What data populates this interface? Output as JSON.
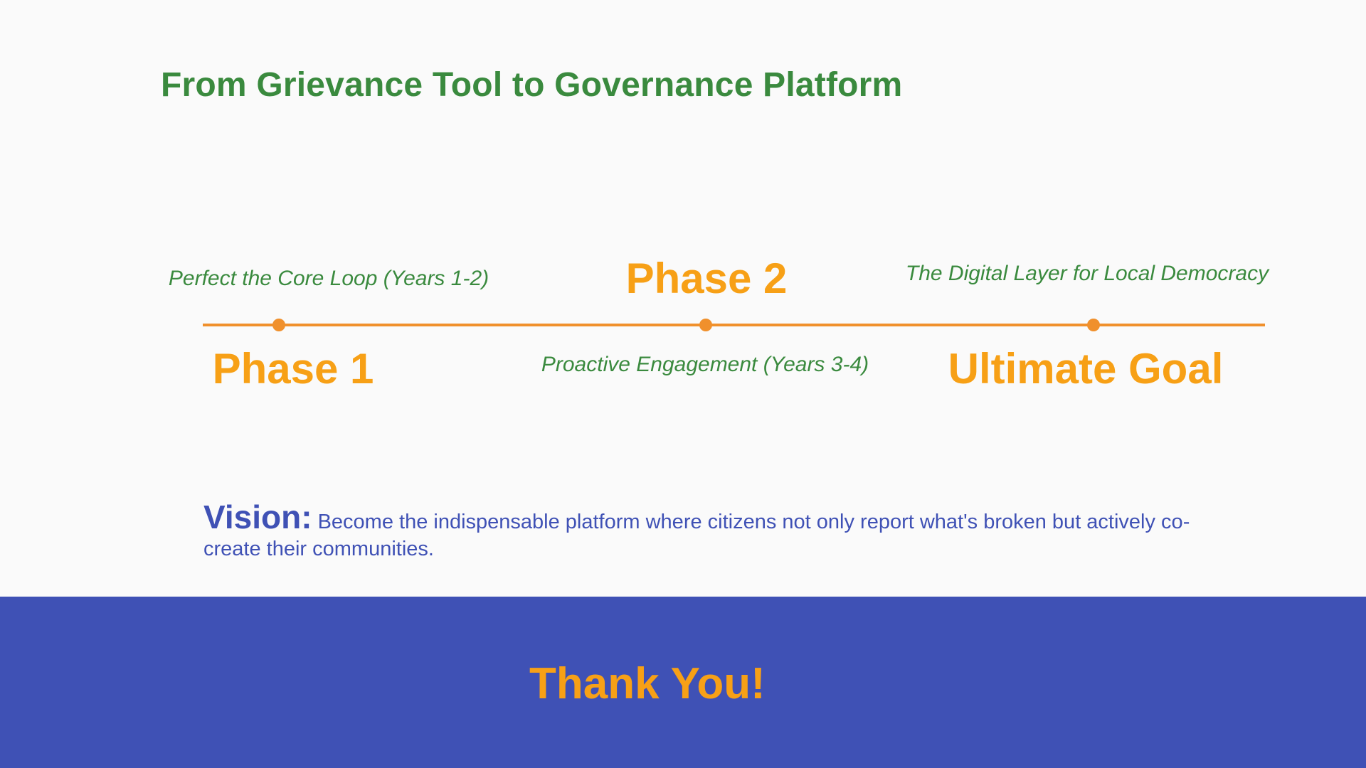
{
  "slide": {
    "title": "From Grievance Tool to Governance Platform"
  },
  "timeline": {
    "accent_color": "#f0902c",
    "milestones": [
      {
        "label": "Phase 1",
        "description": "Perfect the Core Loop (Years 1-2)"
      },
      {
        "label": "Phase 2",
        "description": "Proactive Engagement (Years 3-4)"
      },
      {
        "label": "Ultimate Goal",
        "description": "The Digital Layer for Local Democracy"
      }
    ]
  },
  "vision": {
    "label": "Vision:",
    "text": " Become the indispensable platform where citizens not only report what's broken but actively co-create their communities."
  },
  "footer": {
    "thank_you": "Thank You!",
    "background_color": "#3f51b5"
  },
  "colors": {
    "title_green": "#3a8a3e",
    "milestone_orange": "#f7a016",
    "vision_blue": "#3f51b5",
    "page_background": "#fafafa"
  }
}
